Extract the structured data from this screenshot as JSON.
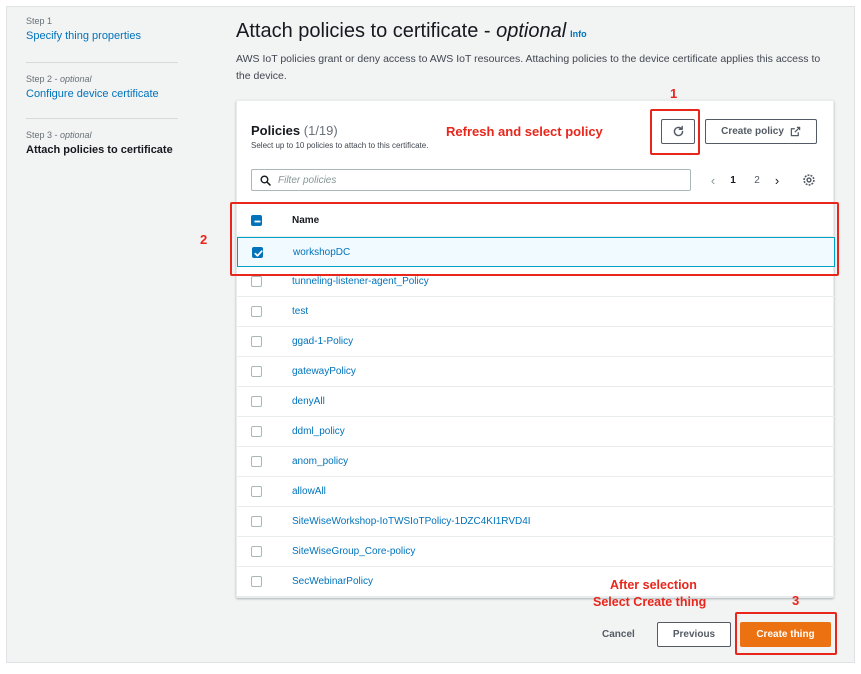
{
  "steps": [
    {
      "caption": "Step 1",
      "caption_optional": "",
      "label": "Specify thing properties"
    },
    {
      "caption": "Step 2 - ",
      "caption_optional": "optional",
      "label": "Configure device certificate"
    },
    {
      "caption": "Step 3 - ",
      "caption_optional": "optional",
      "label": "Attach policies to certificate"
    }
  ],
  "page": {
    "title": "Attach policies to certificate - ",
    "title_optional": "optional",
    "info_label": "Info",
    "description": "AWS IoT policies grant or deny access to AWS IoT resources. Attaching policies to the device certificate applies this access to the device."
  },
  "policies": {
    "title": "Policies",
    "count": "(1/19)",
    "subtitle": "Select up to 10 policies to attach to this certificate.",
    "create_policy_label": "Create policy",
    "filter_placeholder": "Filter policies",
    "pagination": {
      "current": "1",
      "next": "2"
    },
    "column_name": "Name",
    "rows": [
      {
        "name": "workshopDC",
        "checked": true
      },
      {
        "name": "tunneling-listener-agent_Policy",
        "checked": false
      },
      {
        "name": "test",
        "checked": false
      },
      {
        "name": "ggad-1-Policy",
        "checked": false
      },
      {
        "name": "gatewayPolicy",
        "checked": false
      },
      {
        "name": "denyAll",
        "checked": false
      },
      {
        "name": "ddml_policy",
        "checked": false
      },
      {
        "name": "anom_policy",
        "checked": false
      },
      {
        "name": "allowAll",
        "checked": false
      },
      {
        "name": "SiteWiseWorkshop-IoTWSIoTPolicy-1DZC4KI1RVD4I",
        "checked": false
      },
      {
        "name": "SiteWiseGroup_Core-policy",
        "checked": false
      },
      {
        "name": "SecWebinarPolicy",
        "checked": false
      }
    ]
  },
  "footer": {
    "cancel_label": "Cancel",
    "previous_label": "Previous",
    "create_thing_label": "Create thing"
  },
  "annotations": {
    "num1": "1",
    "num2": "2",
    "num3": "3",
    "refresh_note": "Refresh and select policy",
    "after_selection": "After selection",
    "select_create": "Select Create thing"
  },
  "icons": [
    "refresh-icon",
    "external-link-icon",
    "search-icon",
    "settings-gear-icon",
    "chevron-left-icon",
    "chevron-right-icon",
    "checkbox-icon"
  ],
  "colors": {
    "link": "#0073bb",
    "primary": "#ec7211",
    "annotation": "#e8261c",
    "selected_row": "#f1faff"
  }
}
